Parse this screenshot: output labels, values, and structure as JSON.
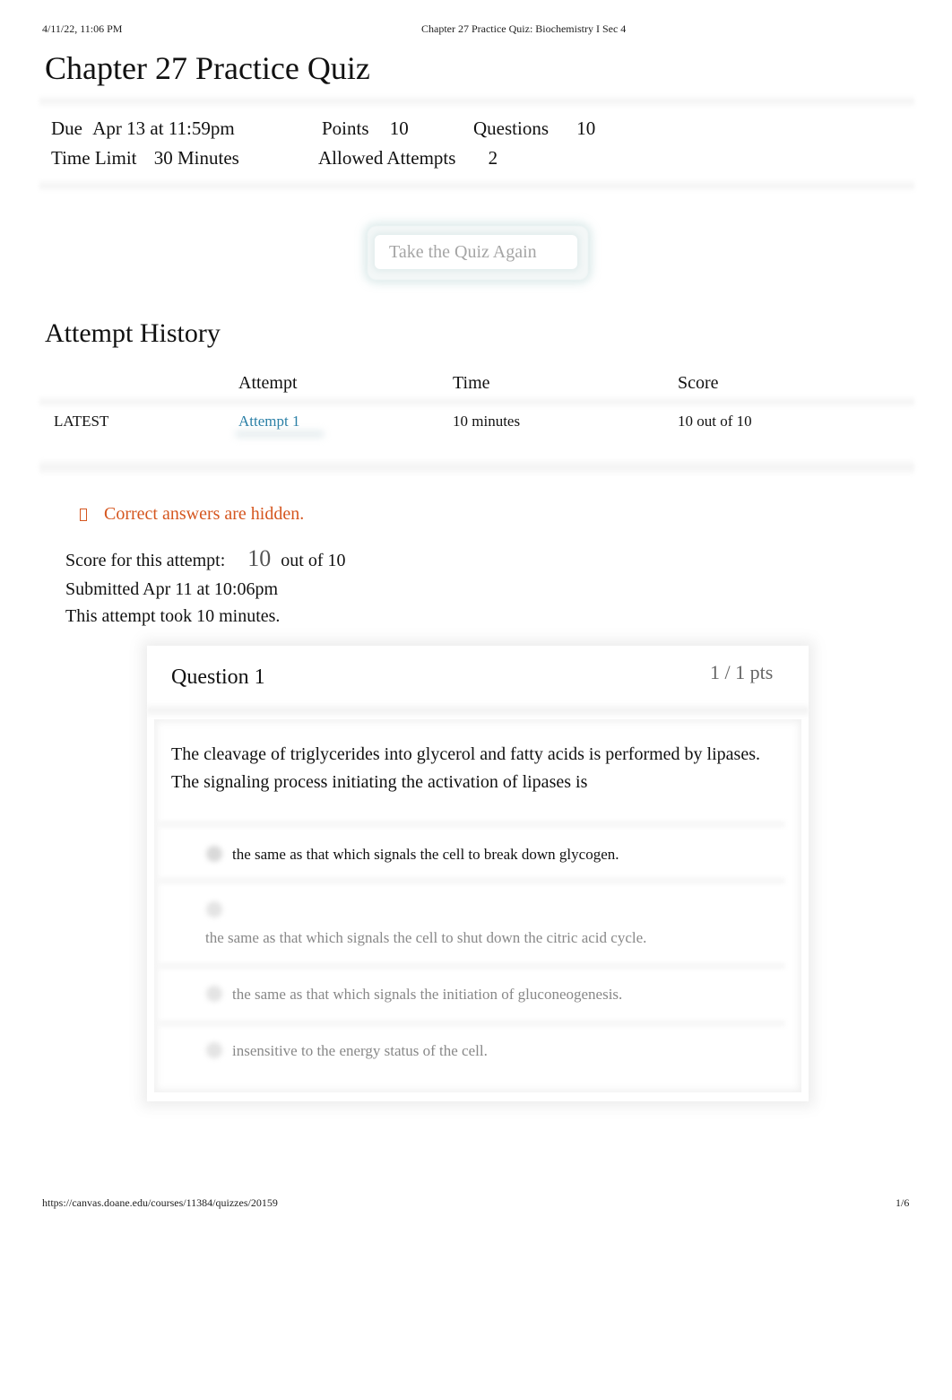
{
  "print_header": {
    "datetime": "4/11/22, 11:06 PM",
    "page_title": "Chapter 27 Practice Quiz: Biochemistry I Sec 4"
  },
  "quiz": {
    "title": "Chapter 27 Practice Quiz",
    "details": {
      "due_label": "Due",
      "due_value": "Apr 13 at 11:59pm",
      "points_label": "Points",
      "points_value": "10",
      "questions_label": "Questions",
      "questions_value": "10",
      "time_limit_label": "Time Limit",
      "time_limit_value": "30 Minutes",
      "allowed_attempts_label": "Allowed Attempts",
      "allowed_attempts_value": "2"
    },
    "retake_button_label": "Take the Quiz Again"
  },
  "attempt_history": {
    "title": "Attempt History",
    "columns": [
      "",
      "Attempt",
      "Time",
      "Score"
    ],
    "rows": [
      {
        "tag": "LATEST",
        "attempt": "Attempt 1",
        "time": "10 minutes",
        "score": "10 out of 10"
      }
    ]
  },
  "result_summary": {
    "notice": "Correct answers are hidden.",
    "notice_icon": "info-icon",
    "notice_color": "#d5561f",
    "score_label": "Score for this attempt:",
    "score_value": "10",
    "score_suffix": "out of 10",
    "submitted": "Submitted Apr 11 at 10:06pm",
    "duration": "This attempt took 10 minutes."
  },
  "questions": [
    {
      "title": "Question 1",
      "points": "1 / 1 pts",
      "text": "The cleavage of triglycerides into glycerol and fatty acids is performed by lipases. The signaling process initiating the activation of lipases is",
      "answers": [
        {
          "text": "the same as that which signals the cell to break down glycogen.",
          "selected": true
        },
        {
          "text": "the same as that which signals the cell to shut down the citric acid cycle.",
          "selected": false
        },
        {
          "text": "the same as that which signals the initiation of gluconeogenesis.",
          "selected": false
        },
        {
          "text": "insensitive to the energy status of the cell.",
          "selected": false
        }
      ]
    }
  ],
  "print_footer": {
    "url": "https://canvas.doane.edu/courses/11384/quizzes/20159",
    "page": "1/6"
  },
  "colors": {
    "link": "#2a7fa6",
    "warning": "#d5561f"
  }
}
